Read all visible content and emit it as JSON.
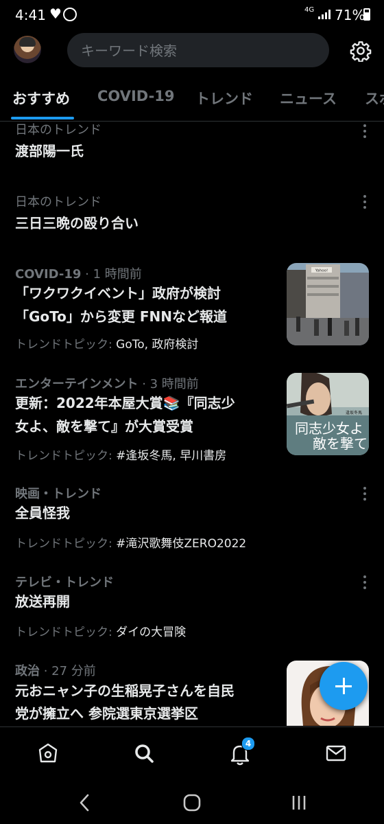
{
  "status_bar": {
    "time": "4:41",
    "network": "4G",
    "battery": "71%"
  },
  "header": {
    "search_placeholder": "キーワード検索"
  },
  "tabs": [
    {
      "label": "おすすめ",
      "active": true
    },
    {
      "label": "COVID-19"
    },
    {
      "label": "トレンド"
    },
    {
      "label": "ニュース"
    },
    {
      "label": "スポ"
    }
  ],
  "feed": [
    {
      "meta": "日本のトレンド",
      "title": "渡部陽一氏"
    },
    {
      "meta": "日本のトレンド",
      "title": "三日三晩の殴り合い"
    },
    {
      "meta_category": "COVID-19",
      "meta_time": " · 1 時間前",
      "title_lines": [
        "「ワクワクイベント」政府が検討",
        "「GoTo」から変更 FNNなど報道"
      ],
      "topic_label": "トレンドトピック: ",
      "topic_value": "GoTo, 政府検討",
      "thumb_signage": "Yahoo!"
    },
    {
      "meta_category": "エンターテインメント",
      "meta_time": " · 3 時間前",
      "title_lines": [
        "更新：2022年本屋大賞📚『同志少",
        "女よ、敵を撃て』が大賞受賞"
      ],
      "topic_label": "トレンドトピック: ",
      "topic_value": "#逢坂冬馬, 早川書房",
      "thumb_cover_lines": [
        "同志少女よ",
        "敵を撃て"
      ],
      "thumb_cover_author": "逢坂冬馬"
    },
    {
      "meta": "映画・トレンド",
      "title": "全員怪我",
      "topic_label": "トレンドトピック: ",
      "topic_value": "#滝沢歌舞伎ZERO2022"
    },
    {
      "meta": "テレビ・トレンド",
      "title": "放送再開",
      "topic_label": "トレンドトピック: ",
      "topic_value": "ダイの大冒険"
    },
    {
      "meta_category": "政治",
      "meta_time": " · 27 分前",
      "title_lines": [
        "元おニャン子の生稲晃子さんを自民",
        "党が擁立へ 参院選東京選挙区"
      ]
    }
  ],
  "bottom_nav": {
    "notifications_badge": "4"
  },
  "colors": {
    "accent": "#1d9bf0",
    "background": "#000000",
    "secondary_text": "#71767b",
    "primary_text": "#e7e9ea"
  }
}
